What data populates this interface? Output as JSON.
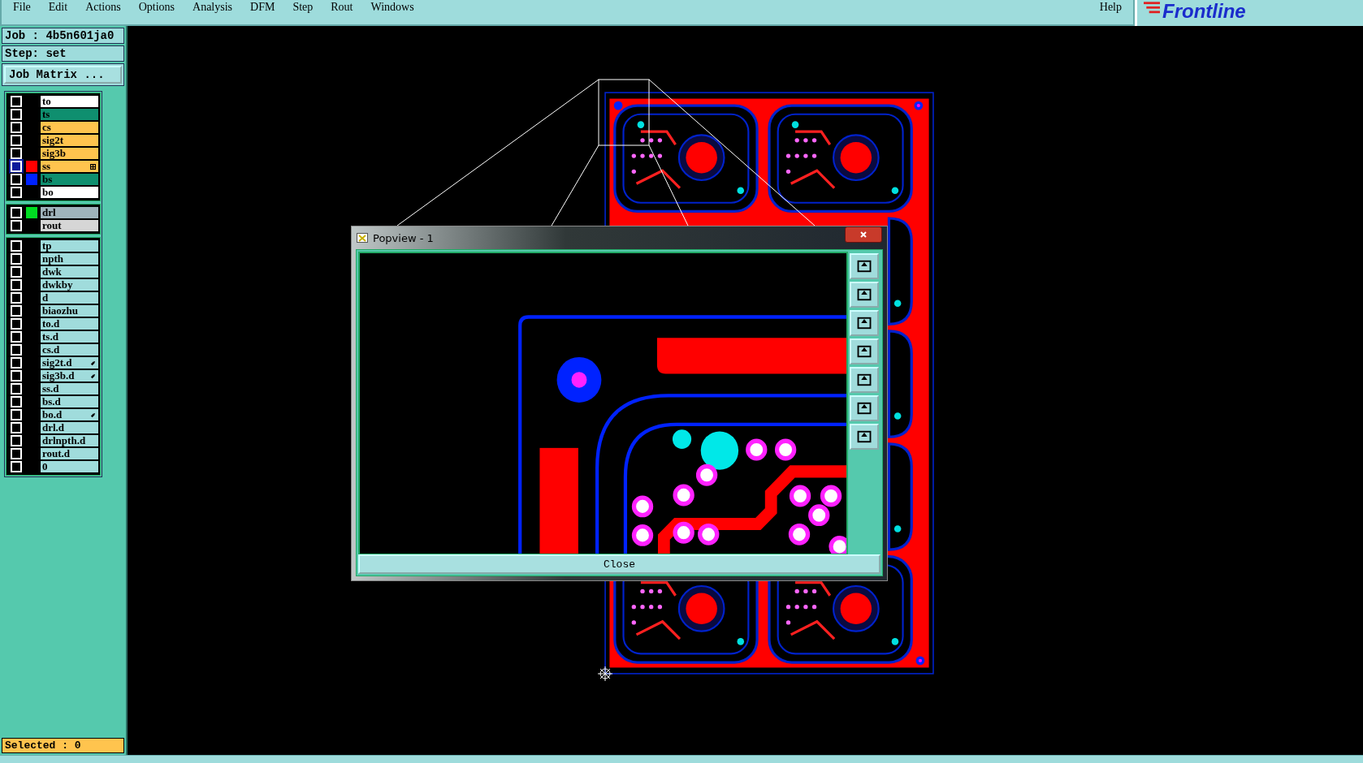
{
  "menu": [
    "File",
    "Edit",
    "Actions",
    "Options",
    "Analysis",
    "DFM",
    "Step",
    "Rout",
    "Windows"
  ],
  "help": "Help",
  "logo": "Frontline",
  "job": "Job : 4b5n601ja0",
  "step": "Step: set",
  "job_matrix_button": "Job Matrix ...",
  "layer_groups": [
    {
      "layers": [
        {
          "name": "to",
          "kind": "silk",
          "selected": false,
          "grid": false,
          "linked": false
        },
        {
          "name": "ts",
          "kind": "mask",
          "selected": false,
          "grid": false,
          "linked": false
        },
        {
          "name": "cs",
          "kind": "signal",
          "selected": false,
          "grid": false,
          "linked": false
        },
        {
          "name": "sig2t",
          "kind": "signal",
          "selected": false,
          "grid": false,
          "linked": false
        },
        {
          "name": "sig3b",
          "kind": "signal",
          "selected": false,
          "grid": false,
          "linked": false
        },
        {
          "name": "ss",
          "kind": "signal",
          "selected": true,
          "grid": true,
          "linked": false,
          "color": "#ff0000"
        },
        {
          "name": "bs",
          "kind": "mask",
          "selected": false,
          "grid": false,
          "linked": false,
          "color": "#0022ff"
        },
        {
          "name": "bo",
          "kind": "silk",
          "selected": false,
          "grid": false,
          "linked": false
        }
      ]
    },
    {
      "layers": [
        {
          "name": "drl",
          "kind": "drill",
          "selected": false,
          "grid": false,
          "linked": false,
          "color": "#00dd22"
        },
        {
          "name": "rout",
          "kind": "rout",
          "selected": false,
          "grid": false,
          "linked": false
        }
      ]
    },
    {
      "layers": [
        {
          "name": "tp",
          "kind": "doc",
          "selected": false,
          "grid": false,
          "linked": false
        },
        {
          "name": "npth",
          "kind": "doc",
          "selected": false,
          "grid": false,
          "linked": false
        },
        {
          "name": "dwk",
          "kind": "doc",
          "selected": false,
          "grid": false,
          "linked": false
        },
        {
          "name": "dwkby",
          "kind": "doc",
          "selected": false,
          "grid": false,
          "linked": false
        },
        {
          "name": "d",
          "kind": "doc",
          "selected": false,
          "grid": false,
          "linked": false
        },
        {
          "name": "biaozhu",
          "kind": "doc",
          "selected": false,
          "grid": false,
          "linked": false
        },
        {
          "name": "to.d",
          "kind": "doc",
          "selected": false,
          "grid": false,
          "linked": false
        },
        {
          "name": "ts.d",
          "kind": "doc",
          "selected": false,
          "grid": false,
          "linked": false
        },
        {
          "name": "cs.d",
          "kind": "doc",
          "selected": false,
          "grid": false,
          "linked": false
        },
        {
          "name": "sig2t.d",
          "kind": "doc",
          "selected": false,
          "grid": false,
          "linked": true
        },
        {
          "name": "sig3b.d",
          "kind": "doc",
          "selected": false,
          "grid": false,
          "linked": true
        },
        {
          "name": "ss.d",
          "kind": "doc",
          "selected": false,
          "grid": false,
          "linked": false
        },
        {
          "name": "bs.d",
          "kind": "doc",
          "selected": false,
          "grid": false,
          "linked": false
        },
        {
          "name": "bo.d",
          "kind": "doc",
          "selected": false,
          "grid": false,
          "linked": true
        },
        {
          "name": "drl.d",
          "kind": "doc",
          "selected": false,
          "grid": false,
          "linked": false
        },
        {
          "name": "drlnpth.d",
          "kind": "doc",
          "selected": false,
          "grid": false,
          "linked": false
        },
        {
          "name": "rout.d",
          "kind": "doc",
          "selected": false,
          "grid": false,
          "linked": false
        },
        {
          "name": "0",
          "kind": "doc",
          "selected": false,
          "grid": false,
          "linked": false
        }
      ]
    }
  ],
  "status": "Selected : 0",
  "popview": {
    "title": "Popview - 1",
    "close_button": "Close"
  }
}
